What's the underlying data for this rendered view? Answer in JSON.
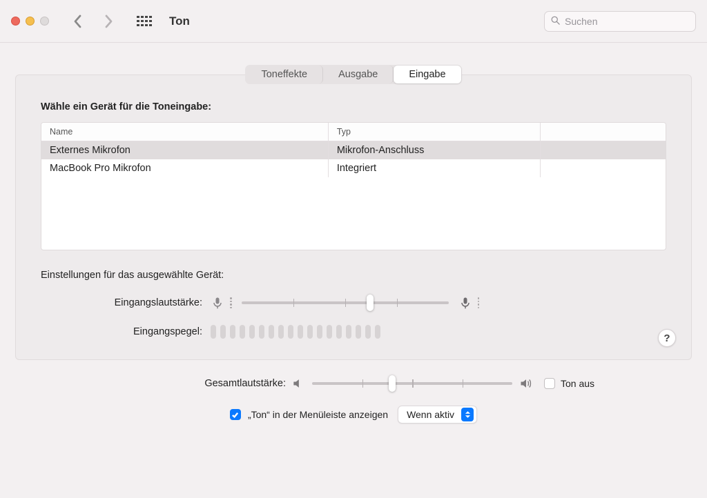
{
  "window": {
    "title": "Ton"
  },
  "search": {
    "placeholder": "Suchen"
  },
  "tabs": {
    "effects": "Toneffekte",
    "output": "Ausgabe",
    "input": "Eingabe",
    "active": "input"
  },
  "section": {
    "title": "Wähle ein Gerät für die Toneingabe:"
  },
  "table": {
    "headers": {
      "name": "Name",
      "type": "Typ"
    },
    "rows": [
      {
        "name": "Externes Mikrofon",
        "type": "Mikrofon-Anschluss",
        "selected": true
      },
      {
        "name": "MacBook Pro Mikrofon",
        "type": "Integriert",
        "selected": false
      }
    ]
  },
  "settings": {
    "caption": "Einstellungen für das ausgewählte Gerät:",
    "input_volume_label": "Eingangslautstärke:",
    "input_volume_percent": 62,
    "input_level_label": "Eingangspegel:",
    "input_level_segments": 18
  },
  "help": {
    "symbol": "?"
  },
  "footer": {
    "overall_label": "Gesamtlautstärke:",
    "overall_percent": 40,
    "mute_label": "Ton aus",
    "mute_checked": false,
    "menubar_label": "„Ton“ in der Menüleiste anzeigen",
    "menubar_checked": true,
    "select_value": "Wenn aktiv"
  }
}
